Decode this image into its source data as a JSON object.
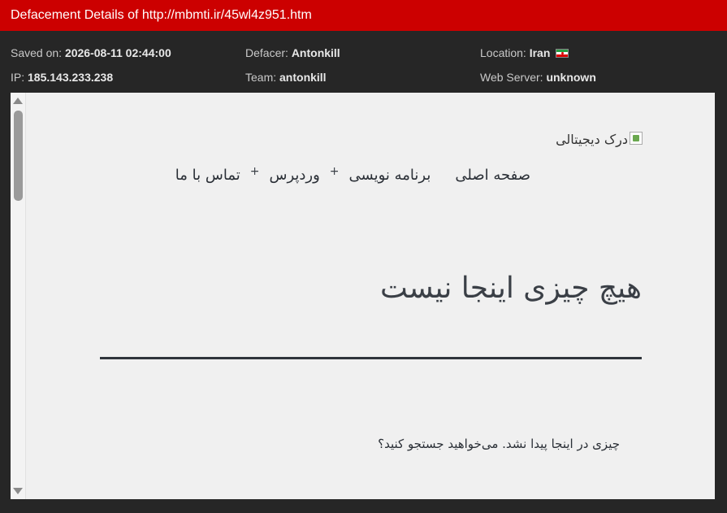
{
  "header": {
    "title": "Defacement Details of http://mbmti.ir/45wl4z951.htm"
  },
  "meta": {
    "saved_on_label": "Saved on:",
    "saved_on": "2026-08-11 02:44:00",
    "defacer_label": "Defacer:",
    "defacer": "Antonkill",
    "location_label": "Location:",
    "location": "Iran",
    "flag_icon": "iran-flag-icon",
    "ip_label": "IP:",
    "ip": "185.143.233.238",
    "team_label": "Team:",
    "team": "antonkill",
    "webserver_label": "Web Server:",
    "webserver": "unknown"
  },
  "mirror": {
    "logo_alt": "درک دیجیتالی",
    "nav": {
      "home": "صفحه اصلی",
      "programming": "برنامه نویسی",
      "wordpress": "وردپرس",
      "contact": "تماس با ما",
      "plus": "+"
    },
    "headline": "هیچ چیزی اینجا نیست",
    "message": "چیزی در اینجا پیدا نشد. می‌خواهید جستجو کنید؟"
  },
  "colors": {
    "header_bg": "#cc0000",
    "meta_bg": "#262626",
    "frame_bg": "#f0f0f0"
  }
}
